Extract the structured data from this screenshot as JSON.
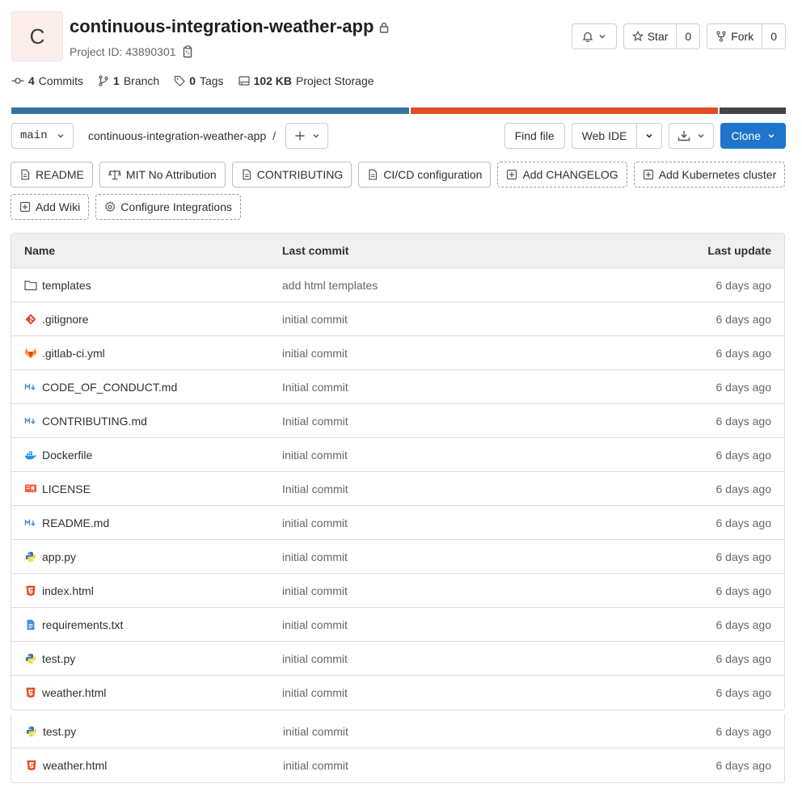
{
  "project": {
    "avatar_letter": "C",
    "name": "continuous-integration-weather-app",
    "project_id_label": "Project ID: 43890301"
  },
  "actions": {
    "star_label": "Star",
    "star_count": "0",
    "fork_label": "Fork",
    "fork_count": "0"
  },
  "stats": {
    "commits_count": "4",
    "commits_label": "Commits",
    "branch_count": "1",
    "branch_label": "Branch",
    "tags_count": "0",
    "tags_label": "Tags",
    "storage_size": "102 KB",
    "storage_label": "Project Storage"
  },
  "language_bar": [
    {
      "color": "#3572a5",
      "percent": 51.6
    },
    {
      "color": "#e34c26",
      "percent": 39.8
    },
    {
      "color": "#444444",
      "percent": 8.6
    }
  ],
  "toolbar": {
    "branch": "main",
    "breadcrumb": "continuous-integration-weather-app",
    "separator": "/",
    "find_file": "Find file",
    "web_ide": "Web IDE",
    "clone": "Clone"
  },
  "quick_links": [
    {
      "label": "README",
      "icon": "doc-icon",
      "dashed": false
    },
    {
      "label": "MIT No Attribution",
      "icon": "scale-icon",
      "dashed": false
    },
    {
      "label": "CONTRIBUTING",
      "icon": "doc-icon",
      "dashed": false
    },
    {
      "label": "CI/CD configuration",
      "icon": "doc-icon",
      "dashed": false
    },
    {
      "label": "Add CHANGELOG",
      "icon": "plus-square-icon",
      "dashed": true
    },
    {
      "label": "Add Kubernetes cluster",
      "icon": "plus-square-icon",
      "dashed": true
    },
    {
      "label": "Add Wiki",
      "icon": "plus-square-icon",
      "dashed": true
    },
    {
      "label": "Configure Integrations",
      "icon": "gear-icon",
      "dashed": true
    }
  ],
  "table": {
    "headers": {
      "name": "Name",
      "last_commit": "Last commit",
      "last_update": "Last update"
    },
    "rows": [
      {
        "name": "templates",
        "icon": "folder-icon",
        "commit": "add html templates",
        "date": "6 days ago"
      },
      {
        "name": ".gitignore",
        "icon": "git-icon",
        "commit": "initial commit",
        "date": "6 days ago"
      },
      {
        "name": ".gitlab-ci.yml",
        "icon": "gitlab-icon",
        "commit": "initial commit",
        "date": "6 days ago"
      },
      {
        "name": "CODE_OF_CONDUCT.md",
        "icon": "markdown-icon",
        "commit": "Initial commit",
        "date": "6 days ago"
      },
      {
        "name": "CONTRIBUTING.md",
        "icon": "markdown-icon",
        "commit": "Initial commit",
        "date": "6 days ago"
      },
      {
        "name": "Dockerfile",
        "icon": "docker-icon",
        "commit": "initial commit",
        "date": "6 days ago"
      },
      {
        "name": "LICENSE",
        "icon": "license-icon",
        "commit": "Initial commit",
        "date": "6 days ago"
      },
      {
        "name": "README.md",
        "icon": "markdown-icon",
        "commit": "initial commit",
        "date": "6 days ago"
      },
      {
        "name": "app.py",
        "icon": "python-icon",
        "commit": "initial commit",
        "date": "6 days ago"
      },
      {
        "name": "index.html",
        "icon": "html-icon",
        "commit": "initial commit",
        "date": "6 days ago"
      },
      {
        "name": "requirements.txt",
        "icon": "text-file-icon",
        "commit": "initial commit",
        "date": "6 days ago"
      },
      {
        "name": "test.py",
        "icon": "python-icon",
        "commit": "initial commit",
        "date": "6 days ago"
      },
      {
        "name": "weather.html",
        "icon": "html-icon",
        "commit": "initial commit",
        "date": "6 days ago"
      }
    ],
    "overflow_rows": [
      {
        "name": "test.py",
        "icon": "python-icon",
        "commit": "initial commit",
        "date": "6 days ago"
      },
      {
        "name": "weather.html",
        "icon": "html-icon",
        "commit": "initial commit",
        "date": "6 days ago"
      }
    ]
  }
}
